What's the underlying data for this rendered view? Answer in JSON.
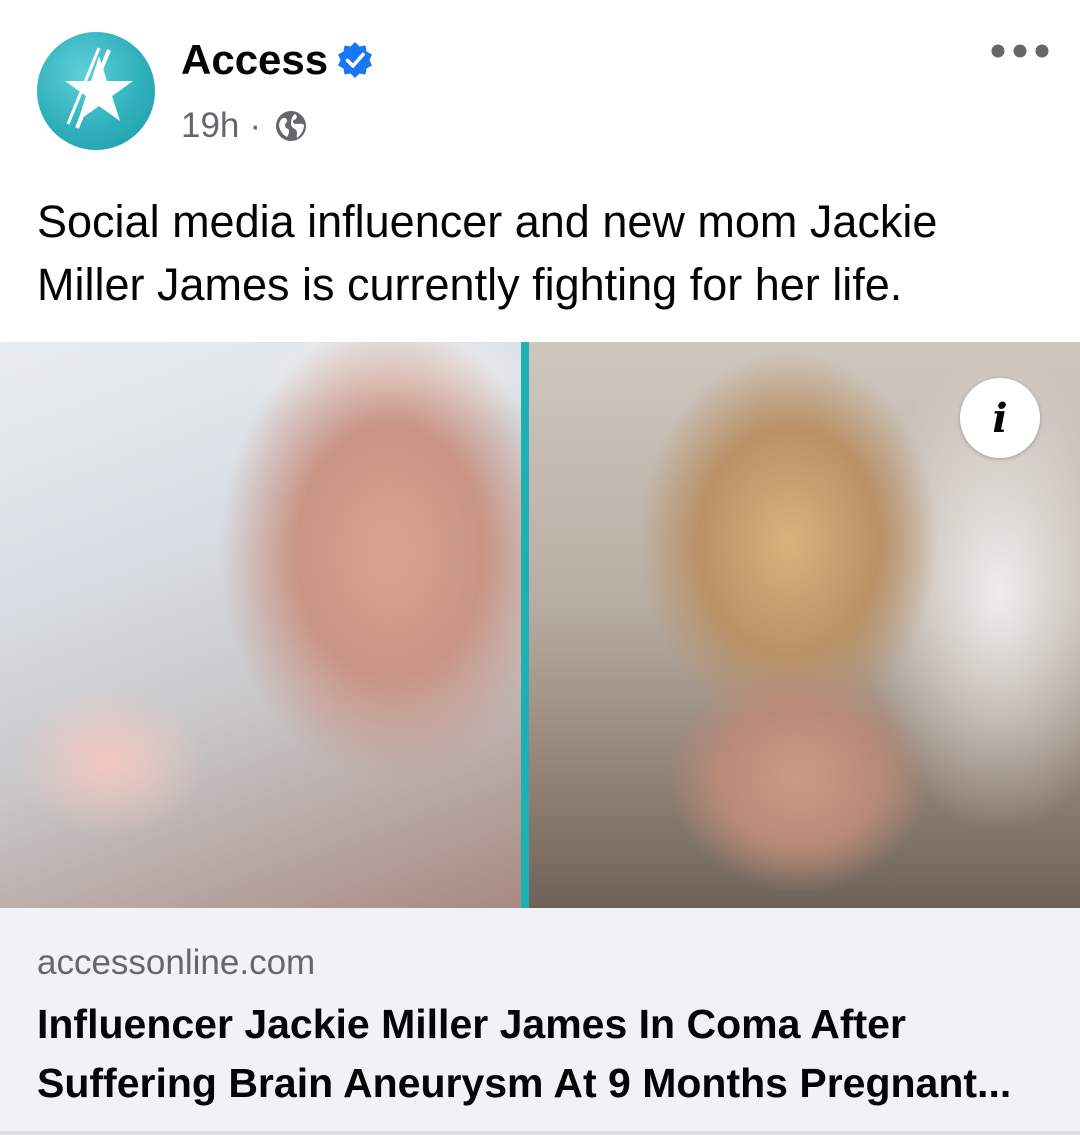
{
  "post": {
    "author": "Access",
    "time": "19h",
    "separator": "·",
    "avatar_icon": "star-logo-icon",
    "verified_icon": "verified-badge-icon",
    "privacy_icon": "globe-icon",
    "more_icon": "more-options-icon",
    "text": "Social media influencer and new mom Jackie Miller James is currently fighting for her life."
  },
  "link": {
    "info_label": "i",
    "domain": "accessonline.com",
    "title": "Influencer Jackie Miller James In Coma After Suffering Brain Aneurysm At 9 Months Pregnant..."
  },
  "colors": {
    "brand_teal": "#2fb0bd",
    "verified_blue": "#1877f2",
    "secondary_text": "#65676b",
    "preview_background": "#f0f2f5"
  }
}
